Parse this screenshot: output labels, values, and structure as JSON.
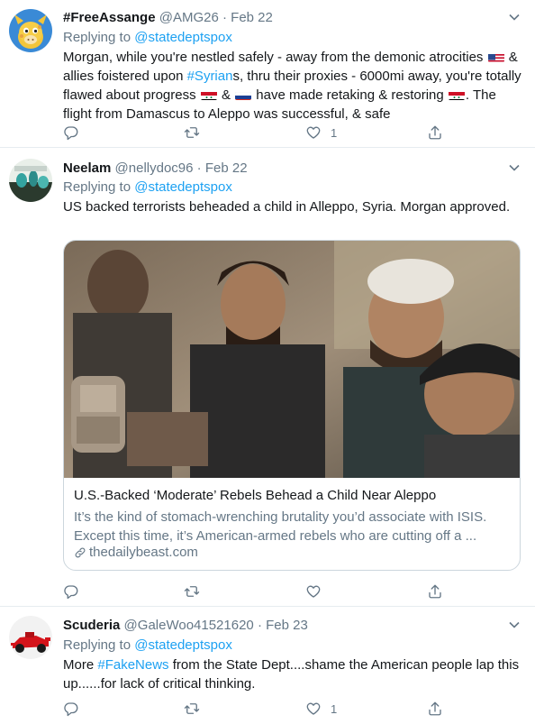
{
  "tweets": [
    {
      "name": "#FreeAssange",
      "handle": "@AMG26",
      "separator": "·",
      "date": "Feb 22",
      "replying_prefix": "Replying to",
      "replying_to": "@statedeptspox",
      "text": {
        "p1": "Morgan, while you're nestled safely - away from the demonic atrocities",
        "p2": "& allies foistered upon",
        "hashtag": "#Syrian",
        "p3": "s, thru their proxies - 6000mi away, you're totally flawed about progress",
        "p4": "&",
        "p5": "have made retaking & restoring",
        "p6": ". The flight from Damascus to Aleppo was successful, & safe"
      },
      "actions": {
        "reply": "",
        "retweet": "",
        "like": "1"
      }
    },
    {
      "name": "Neelam",
      "handle": "@nellydoc96",
      "separator": "·",
      "date": "Feb 22",
      "replying_prefix": "Replying to",
      "replying_to": "@statedeptspox",
      "text": "US backed terrorists beheaded a child in  Alleppo, Syria. Morgan approved.",
      "card": {
        "title": "U.S.-Backed ‘Moderate’ Rebels Behead a Child Near Aleppo",
        "description": "It’s the kind of stomach-wrenching brutality you’d associate with ISIS. Except this time, it’s American-armed rebels who are cutting off a ...",
        "domain": "thedailybeast.com"
      },
      "actions": {
        "reply": "",
        "retweet": "",
        "like": ""
      }
    },
    {
      "name": "Scuderia",
      "handle": "@GaleWoo41521620",
      "separator": "·",
      "date": "Feb 23",
      "replying_prefix": "Replying to",
      "replying_to": "@statedeptspox",
      "text": {
        "p1": "More",
        "hashtag": "#FakeNews",
        "p2": "from the State Dept....shame the American people lap this up......for lack of critical thinking."
      },
      "actions": {
        "reply": "",
        "retweet": "",
        "like": "1"
      }
    }
  ],
  "icons": [
    "reply-icon",
    "retweet-icon",
    "like-icon",
    "share-icon",
    "chevron-down-icon",
    "link-icon"
  ],
  "colors": {
    "link": "#1da1f2",
    "muted": "#657786",
    "text": "#14171a",
    "border": "#e6ecf0"
  }
}
